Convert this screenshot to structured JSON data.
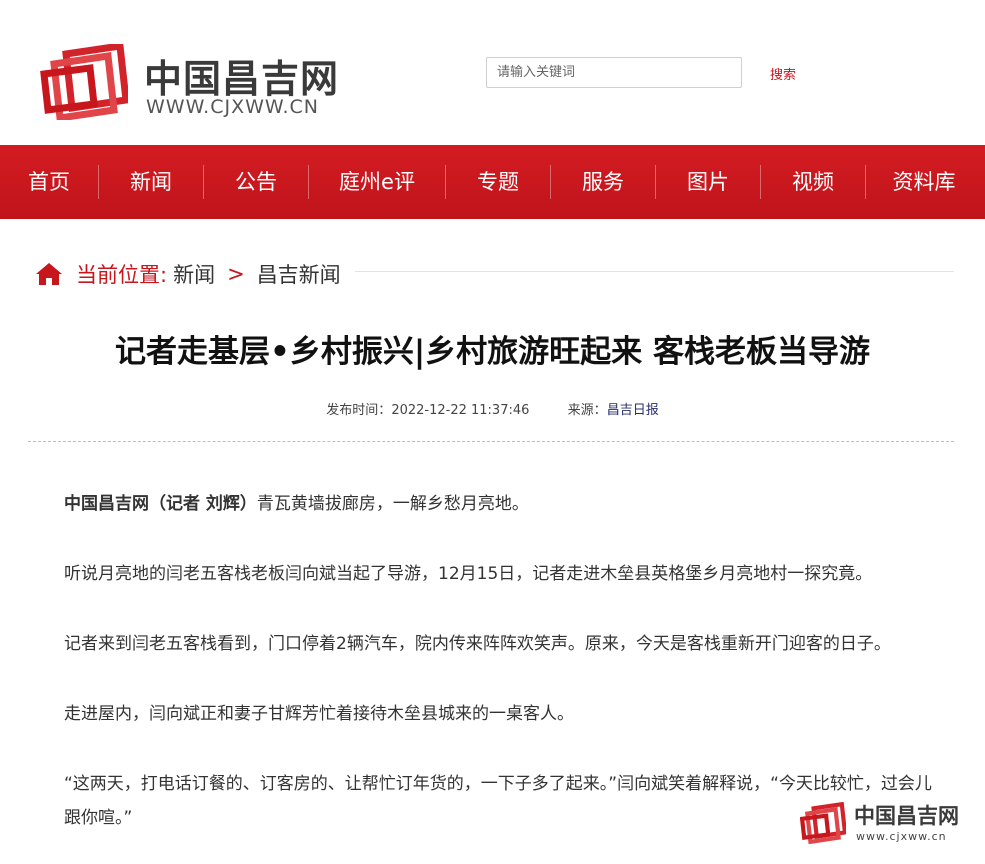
{
  "site": {
    "name": "中国昌吉网",
    "url_text": "WWW.CJXWW.CN",
    "brand_color": "#c8161d"
  },
  "search": {
    "placeholder": "请输入关键词",
    "button_label": "搜索"
  },
  "nav": {
    "items": [
      "首页",
      "新闻",
      "公告",
      "庭州e评",
      "专题",
      "服务",
      "图片",
      "视频",
      "资料库"
    ]
  },
  "breadcrumb": {
    "label": "当前位置:",
    "items": [
      "新闻",
      "昌吉新闻"
    ],
    "separator": ">"
  },
  "article": {
    "title": "记者走基层•乡村振兴|乡村旅游旺起来 客栈老板当导游",
    "publish_label": "发布时间：",
    "publish_time": "2022-12-22 11:37:46",
    "source_label": "来源：",
    "source": "昌吉日报",
    "lead_bold": "中国昌吉网（记者 刘辉）",
    "lead_text": "青瓦黄墙拔廊房，一解乡愁月亮地。",
    "paragraphs": [
      "听说月亮地的闫老五客栈老板闫向斌当起了导游，12月15日，记者走进木垒县英格堡乡月亮地村一探究竟。",
      "记者来到闫老五客栈看到，门口停着2辆汽车，院内传来阵阵欢笑声。原来，今天是客栈重新开门迎客的日子。",
      "走进屋内，闫向斌正和妻子甘辉芳忙着接待木垒县城来的一桌客人。",
      "“这两天，打电话订餐的、订客房的、让帮忙订年货的，一下子多了起来。”闫向斌笑着解释说，“今天比较忙，过会儿跟你喧。”"
    ]
  },
  "watermark": {
    "name": "中国昌吉网",
    "url_text": "www.cjxww.cn"
  }
}
